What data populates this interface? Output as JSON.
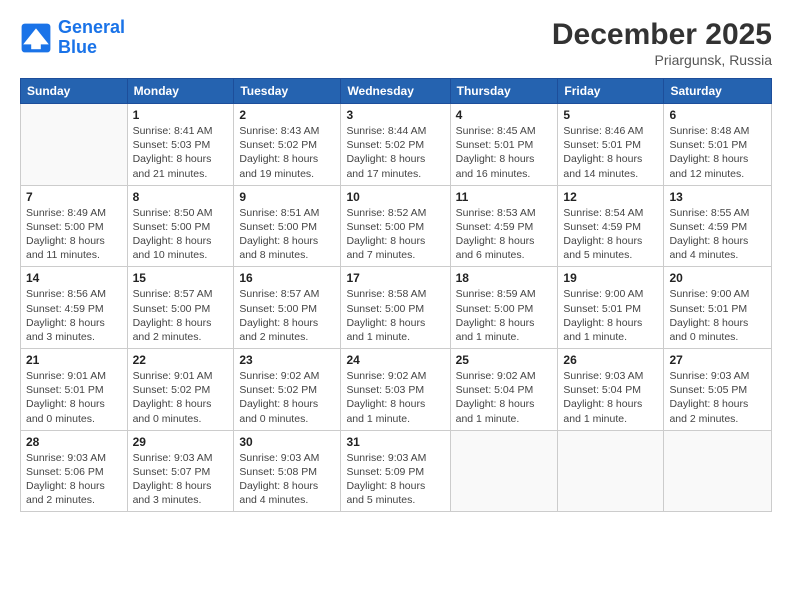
{
  "header": {
    "logo_line1": "General",
    "logo_line2": "Blue",
    "month": "December 2025",
    "location": "Priargunsk, Russia"
  },
  "weekdays": [
    "Sunday",
    "Monday",
    "Tuesday",
    "Wednesday",
    "Thursday",
    "Friday",
    "Saturday"
  ],
  "weeks": [
    [
      {
        "day": "",
        "info": ""
      },
      {
        "day": "1",
        "info": "Sunrise: 8:41 AM\nSunset: 5:03 PM\nDaylight: 8 hours\nand 21 minutes."
      },
      {
        "day": "2",
        "info": "Sunrise: 8:43 AM\nSunset: 5:02 PM\nDaylight: 8 hours\nand 19 minutes."
      },
      {
        "day": "3",
        "info": "Sunrise: 8:44 AM\nSunset: 5:02 PM\nDaylight: 8 hours\nand 17 minutes."
      },
      {
        "day": "4",
        "info": "Sunrise: 8:45 AM\nSunset: 5:01 PM\nDaylight: 8 hours\nand 16 minutes."
      },
      {
        "day": "5",
        "info": "Sunrise: 8:46 AM\nSunset: 5:01 PM\nDaylight: 8 hours\nand 14 minutes."
      },
      {
        "day": "6",
        "info": "Sunrise: 8:48 AM\nSunset: 5:01 PM\nDaylight: 8 hours\nand 12 minutes."
      }
    ],
    [
      {
        "day": "7",
        "info": "Sunrise: 8:49 AM\nSunset: 5:00 PM\nDaylight: 8 hours\nand 11 minutes."
      },
      {
        "day": "8",
        "info": "Sunrise: 8:50 AM\nSunset: 5:00 PM\nDaylight: 8 hours\nand 10 minutes."
      },
      {
        "day": "9",
        "info": "Sunrise: 8:51 AM\nSunset: 5:00 PM\nDaylight: 8 hours\nand 8 minutes."
      },
      {
        "day": "10",
        "info": "Sunrise: 8:52 AM\nSunset: 5:00 PM\nDaylight: 8 hours\nand 7 minutes."
      },
      {
        "day": "11",
        "info": "Sunrise: 8:53 AM\nSunset: 4:59 PM\nDaylight: 8 hours\nand 6 minutes."
      },
      {
        "day": "12",
        "info": "Sunrise: 8:54 AM\nSunset: 4:59 PM\nDaylight: 8 hours\nand 5 minutes."
      },
      {
        "day": "13",
        "info": "Sunrise: 8:55 AM\nSunset: 4:59 PM\nDaylight: 8 hours\nand 4 minutes."
      }
    ],
    [
      {
        "day": "14",
        "info": "Sunrise: 8:56 AM\nSunset: 4:59 PM\nDaylight: 8 hours\nand 3 minutes."
      },
      {
        "day": "15",
        "info": "Sunrise: 8:57 AM\nSunset: 5:00 PM\nDaylight: 8 hours\nand 2 minutes."
      },
      {
        "day": "16",
        "info": "Sunrise: 8:57 AM\nSunset: 5:00 PM\nDaylight: 8 hours\nand 2 minutes."
      },
      {
        "day": "17",
        "info": "Sunrise: 8:58 AM\nSunset: 5:00 PM\nDaylight: 8 hours\nand 1 minute."
      },
      {
        "day": "18",
        "info": "Sunrise: 8:59 AM\nSunset: 5:00 PM\nDaylight: 8 hours\nand 1 minute."
      },
      {
        "day": "19",
        "info": "Sunrise: 9:00 AM\nSunset: 5:01 PM\nDaylight: 8 hours\nand 1 minute."
      },
      {
        "day": "20",
        "info": "Sunrise: 9:00 AM\nSunset: 5:01 PM\nDaylight: 8 hours\nand 0 minutes."
      }
    ],
    [
      {
        "day": "21",
        "info": "Sunrise: 9:01 AM\nSunset: 5:01 PM\nDaylight: 8 hours\nand 0 minutes."
      },
      {
        "day": "22",
        "info": "Sunrise: 9:01 AM\nSunset: 5:02 PM\nDaylight: 8 hours\nand 0 minutes."
      },
      {
        "day": "23",
        "info": "Sunrise: 9:02 AM\nSunset: 5:02 PM\nDaylight: 8 hours\nand 0 minutes."
      },
      {
        "day": "24",
        "info": "Sunrise: 9:02 AM\nSunset: 5:03 PM\nDaylight: 8 hours\nand 1 minute."
      },
      {
        "day": "25",
        "info": "Sunrise: 9:02 AM\nSunset: 5:04 PM\nDaylight: 8 hours\nand 1 minute."
      },
      {
        "day": "26",
        "info": "Sunrise: 9:03 AM\nSunset: 5:04 PM\nDaylight: 8 hours\nand 1 minute."
      },
      {
        "day": "27",
        "info": "Sunrise: 9:03 AM\nSunset: 5:05 PM\nDaylight: 8 hours\nand 2 minutes."
      }
    ],
    [
      {
        "day": "28",
        "info": "Sunrise: 9:03 AM\nSunset: 5:06 PM\nDaylight: 8 hours\nand 2 minutes."
      },
      {
        "day": "29",
        "info": "Sunrise: 9:03 AM\nSunset: 5:07 PM\nDaylight: 8 hours\nand 3 minutes."
      },
      {
        "day": "30",
        "info": "Sunrise: 9:03 AM\nSunset: 5:08 PM\nDaylight: 8 hours\nand 4 minutes."
      },
      {
        "day": "31",
        "info": "Sunrise: 9:03 AM\nSunset: 5:09 PM\nDaylight: 8 hours\nand 5 minutes."
      },
      {
        "day": "",
        "info": ""
      },
      {
        "day": "",
        "info": ""
      },
      {
        "day": "",
        "info": ""
      }
    ]
  ]
}
